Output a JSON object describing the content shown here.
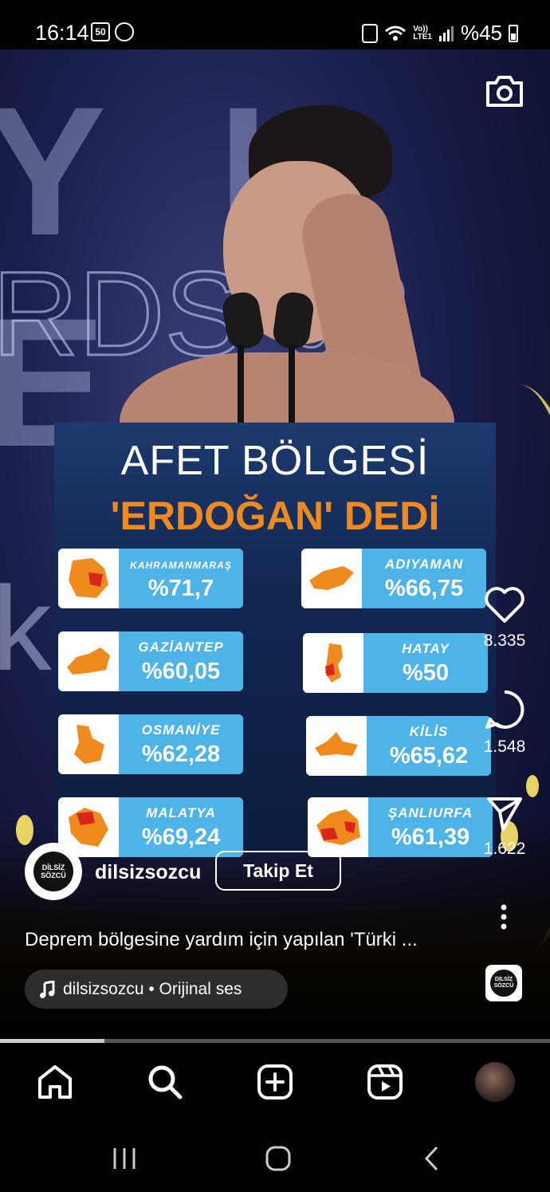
{
  "status_bar": {
    "time": "16:14",
    "left_badge": "50",
    "network_top": "Vo))",
    "network_bottom": "LTE1",
    "battery": "%45"
  },
  "infographic": {
    "title": "AFET BÖLGESİ",
    "subtitle": "'ERDOĞAN' DEDİ",
    "regions": [
      {
        "name": "KAHRAMANMARAŞ",
        "value": "%71,7"
      },
      {
        "name": "ADIYAMAN",
        "value": "%66,75"
      },
      {
        "name": "GAZİANTEP",
        "value": "%60,05"
      },
      {
        "name": "HATAY",
        "value": "%50"
      },
      {
        "name": "OSMANİYE",
        "value": "%62,28"
      },
      {
        "name": "KİLİS",
        "value": "%65,62"
      },
      {
        "name": "MALATYA",
        "value": "%69,24"
      },
      {
        "name": "ŞANLIURFA",
        "value": "%61,39"
      }
    ]
  },
  "actions": {
    "likes": "8.335",
    "comments": "1.548",
    "shares": "1.622"
  },
  "post": {
    "username": "dilsizsozcu",
    "avatar_text": "DİLSİZ SÖZCÜ",
    "follow_label": "Takip Et",
    "caption": "Deprem bölgesine yardım için yapılan 'Türki ...",
    "audio": "dilsizsozcu • Orijinal ses"
  },
  "video_progress": 0.19,
  "icons": [
    "camera-icon",
    "heart-icon",
    "comment-icon",
    "send-icon",
    "more-icon",
    "music-note-icon",
    "home-icon",
    "search-icon",
    "add-icon",
    "reels-icon",
    "recents-icon",
    "home-circle-icon",
    "back-icon"
  ]
}
